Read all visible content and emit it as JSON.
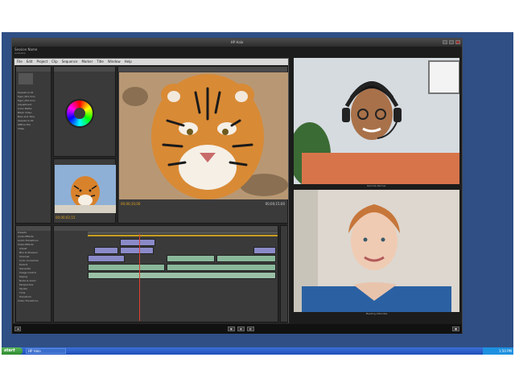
{
  "window": {
    "title": "HP Halo"
  },
  "session": {
    "name": "Session Name",
    "subtitle": "Available"
  },
  "premiere": {
    "menu": [
      "File",
      "Edit",
      "Project",
      "Clip",
      "Sequence",
      "Marker",
      "Title",
      "Window",
      "Help"
    ],
    "project_items": [
      "Sequence 01",
      "tiger_001.mov",
      "tiger_002.mov",
      "Adjustment",
      "Color Matte",
      "Black Video",
      "Bars and Tone",
      "Sequence 02",
      "Offline File",
      "Titles"
    ],
    "effects_items": [
      "Presets",
      "Audio Effects",
      "Audio Transitions",
      "Video Effects",
      "Adjust",
      "Blur & Sharpen",
      "Channel",
      "Color Correction",
      "Distort",
      "Generate",
      "Image Control",
      "Keying",
      "Noise & Grain",
      "Perspective",
      "Stylize",
      "Time",
      "Transform",
      "Video Transitions"
    ],
    "timecode_program": "00;00;10;00",
    "timecode_source": "00;00;02;15",
    "timecode_end": "00;00;15;00"
  },
  "participants": [
    {
      "label": "Remote Partner"
    },
    {
      "label": "Meeting Attendee"
    }
  ],
  "taskbar": {
    "start": "start",
    "task": "HP Halo",
    "clock": "1:50 PM"
  }
}
